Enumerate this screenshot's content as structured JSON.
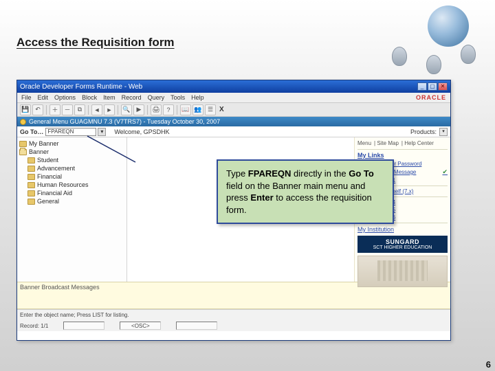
{
  "heading": "Access the Requisition form",
  "window": {
    "title": "Oracle Developer Forms Runtime - Web",
    "menus": [
      "File",
      "Edit",
      "Options",
      "Block",
      "Item",
      "Record",
      "Query",
      "Tools",
      "Help"
    ],
    "oracle_logo": "ORACLE",
    "inner_title": "General Menu  GUAGMNU  7.3  (V7TRS7) - Tuesday October 30, 2007",
    "toolbar_x": "X",
    "go_to_label": "Go To…",
    "go_to_value": "FPAREQN",
    "welcome": "Welcome, GPSDHK",
    "products_label": "Products:"
  },
  "tree": {
    "root": "My Banner",
    "top": "Banner",
    "items": [
      "Student",
      "Advancement",
      "Financial",
      "Human Resources",
      "Financial Aid",
      "General"
    ]
  },
  "right": {
    "tabs": [
      "Menu",
      "Site Map",
      "Help Center"
    ],
    "mylinks": "My Links",
    "links": [
      {
        "label": "Change Banner Password",
        "check": false
      },
      {
        "label": "Check Banner Message",
        "check": true
      },
      {
        "label": "Personal Link 1",
        "check": false
      },
      {
        "label": "Banner Bookshelf (7.x)",
        "check": false
      },
      {
        "label": "Personal Link 4",
        "check": false
      },
      {
        "label": "Personal Link 5",
        "check": false
      },
      {
        "label": "Personal Link 6",
        "check": false
      }
    ],
    "myinst": "My Institution",
    "sungard_big": "SUNGARD",
    "sungard_small": "SCT HIGHER EDUCATION"
  },
  "callout": {
    "t1": "Type ",
    "t2": "FPAREQN",
    "t3": " directly in the ",
    "t4": "Go To",
    "t5": " field on the Banner main menu and press ",
    "t6": "Enter",
    "t7": " to access the requisition form."
  },
  "broadcast": "Banner Broadcast Messages",
  "status1": "Enter the object name; Press LIST for listing.",
  "status2": {
    "record": "Record: 1/1",
    "mode": "<OSC>"
  },
  "page_num": "6"
}
